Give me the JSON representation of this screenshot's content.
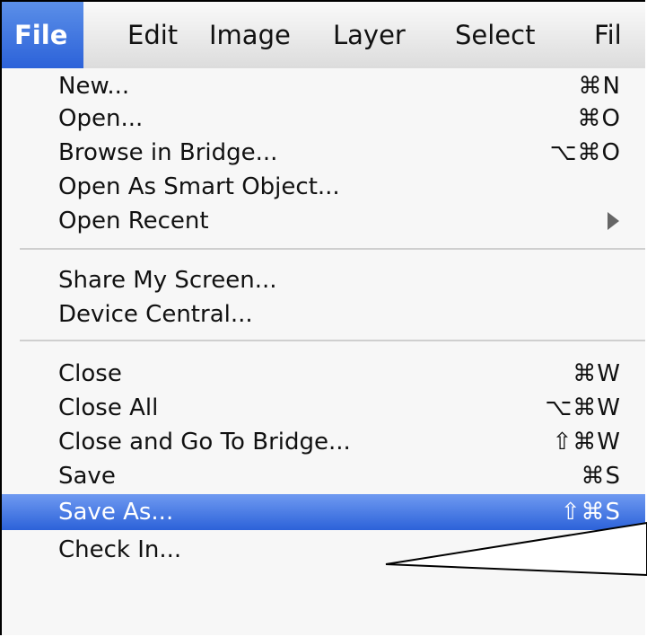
{
  "menubar": {
    "items": [
      {
        "label": "File",
        "active": true
      },
      {
        "label": "Edit",
        "active": false
      },
      {
        "label": "Image",
        "active": false
      },
      {
        "label": "Layer",
        "active": false
      },
      {
        "label": "Select",
        "active": false
      },
      {
        "label": "Fil",
        "active": false
      }
    ]
  },
  "file_menu": {
    "items": [
      {
        "label": "New...",
        "shortcut": "⌘N"
      },
      {
        "label": "Open...",
        "shortcut": "⌘O"
      },
      {
        "label": "Browse in Bridge...",
        "shortcut": "⌥⌘O"
      },
      {
        "label": "Open As Smart Object...",
        "shortcut": ""
      },
      {
        "label": "Open Recent",
        "shortcut": ""
      },
      {
        "label": "Share My Screen...",
        "shortcut": ""
      },
      {
        "label": "Device Central...",
        "shortcut": ""
      },
      {
        "label": "Close",
        "shortcut": "⌘W"
      },
      {
        "label": "Close All",
        "shortcut": "⌥⌘W"
      },
      {
        "label": "Close and Go To Bridge...",
        "shortcut": "⇧⌘W"
      },
      {
        "label": "Save",
        "shortcut": "⌘S"
      },
      {
        "label": "Save As...",
        "shortcut": "⇧⌘S"
      },
      {
        "label": "Check In...",
        "shortcut": ""
      }
    ]
  },
  "colors": {
    "highlight": "#2c62d9",
    "menu_bg": "#f7f7f7",
    "separator": "#cfcfcf"
  }
}
